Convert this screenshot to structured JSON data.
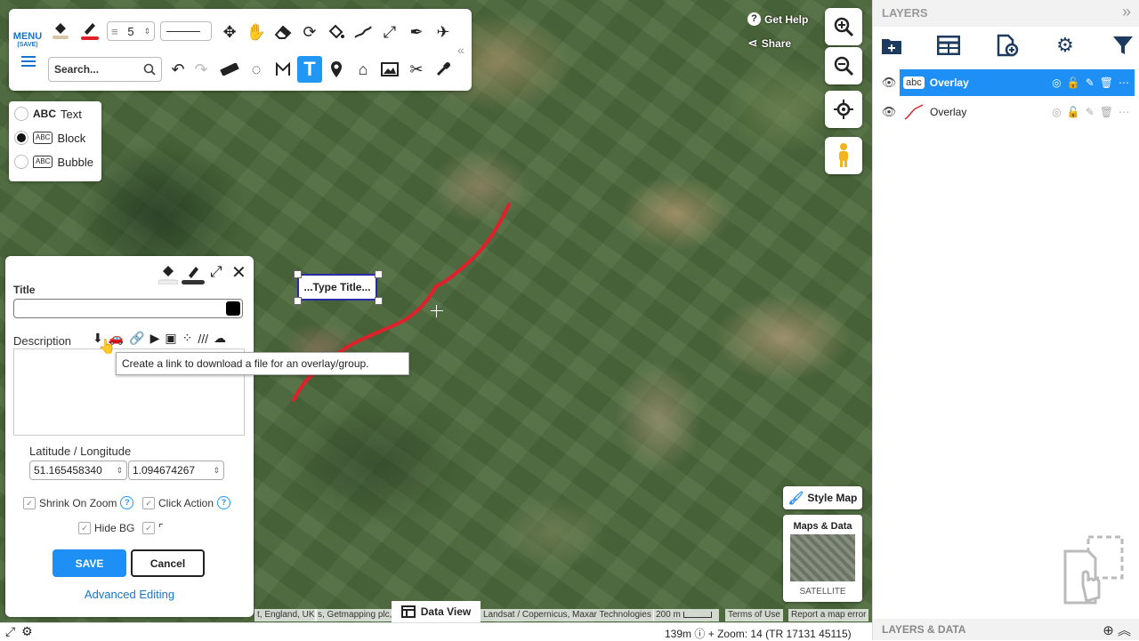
{
  "toolbar": {
    "menu_label": "MENU",
    "menu_sub": "(SAVE)",
    "stroke_width": "5",
    "search_placeholder": "Search...",
    "collapse": "«"
  },
  "text_types": [
    {
      "icon": "ABC",
      "label": "Text",
      "selected": false
    },
    {
      "icon": "ABC",
      "label": "Block",
      "selected": true
    },
    {
      "icon": "ABC",
      "label": "Bubble",
      "selected": false
    }
  ],
  "label_box": {
    "text": "...Type Title..."
  },
  "edit_panel": {
    "title_label": "Title",
    "title_value": "",
    "description_label": "Description",
    "tooltip": "Create a link to download a file for an overlay/group.",
    "latlng_label": "Latitude / Longitude",
    "latitude": "51.165458340",
    "longitude": "1.094674267",
    "shrink_on_zoom": "Shrink On Zoom",
    "click_action": "Click Action",
    "hide_bg": "Hide BG",
    "help_glyph": "?",
    "save": "SAVE",
    "cancel": "Cancel",
    "advanced": "Advanced Editing"
  },
  "map_controls": {
    "get_help": "Get Help",
    "share": "Share",
    "style_map": "Style Map",
    "maps_data_title": "Maps & Data",
    "maps_data_type": "SATELLITE",
    "data_view": "Data View"
  },
  "attribution": {
    "left": "t, England, UK",
    "getmapping": "s, Getmapping plc, In",
    "landsat": "Landsat / Copernicus, Maxar Technologies",
    "scale": "200 m",
    "terms": "Terms of Use",
    "report": "Report a map error"
  },
  "bottom_bar": {
    "distance": "139m",
    "zoom_text": "Zoom: 14 (TR 17131 45115)"
  },
  "layers": {
    "header": "LAYERS",
    "collapse": "»",
    "rows": [
      {
        "type_icon": "abc",
        "name": "Overlay",
        "selected": true
      },
      {
        "type_icon": "line",
        "name": "Overlay",
        "selected": false
      }
    ],
    "footer": "LAYERS & DATA"
  },
  "colors": {
    "accent": "#1e90f5",
    "route": "#e0202a",
    "selection_border": "#2a2aa8",
    "dark_icon": "#1c3b5e"
  }
}
